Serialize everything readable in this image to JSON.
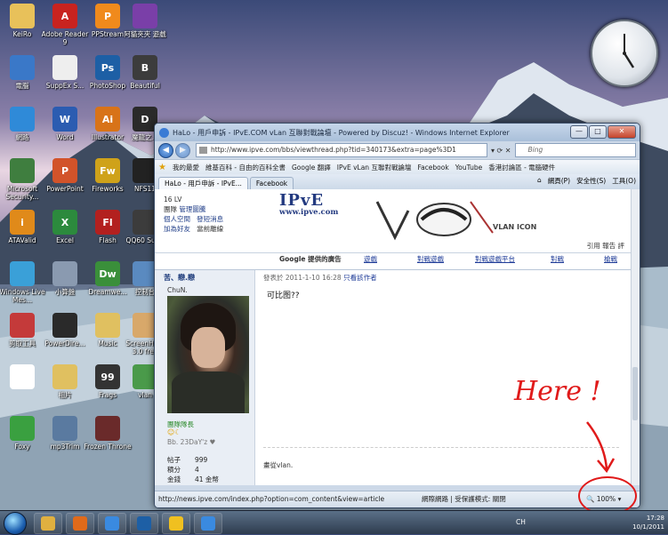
{
  "desktop_icons": [
    {
      "label": "KeiRo",
      "color": "#e8c15a",
      "glyph": ""
    },
    {
      "label": "Adobe Reader 9",
      "color": "#c8231f",
      "glyph": "A"
    },
    {
      "label": "PPStream",
      "color": "#f08a1c",
      "glyph": "P"
    },
    {
      "label": "阿貓夾夾 遊戲",
      "color": "#7a3fa8",
      "glyph": ""
    },
    {
      "label": "電腦",
      "color": "#3a78c8",
      "glyph": ""
    },
    {
      "label": "SuppEx S...",
      "color": "#eeeeee",
      "glyph": ""
    },
    {
      "label": "PhotoShop",
      "color": "#1d5fa5",
      "glyph": "Ps"
    },
    {
      "label": "Beautiful",
      "color": "#3c3c3c",
      "glyph": "B"
    },
    {
      "label": "網路",
      "color": "#2f8ad8",
      "glyph": ""
    },
    {
      "label": "Word",
      "color": "#2b5cb1",
      "glyph": "W"
    },
    {
      "label": "Illustrator",
      "color": "#d87318",
      "glyph": "Ai"
    },
    {
      "label": "魔龍之...",
      "color": "#2a2a2a",
      "glyph": "D"
    },
    {
      "label": "Microsoft Security...",
      "color": "#3f7e3f",
      "glyph": ""
    },
    {
      "label": "PowerPoint",
      "color": "#d2532a",
      "glyph": "P"
    },
    {
      "label": "Fireworks",
      "color": "#cfa21a",
      "glyph": "Fw"
    },
    {
      "label": "NFS11",
      "color": "#222222",
      "glyph": ""
    },
    {
      "label": "ATAValid",
      "color": "#e08a1a",
      "glyph": "i"
    },
    {
      "label": "Excel",
      "color": "#2c8a3d",
      "glyph": "X"
    },
    {
      "label": "Flash",
      "color": "#b3201f",
      "glyph": "Fl"
    },
    {
      "label": "QQ60 Sulte",
      "color": "#3c3c3c",
      "glyph": ""
    },
    {
      "label": "Windows Live Mes...",
      "color": "#3aa0d8",
      "glyph": ""
    },
    {
      "label": "小算盤",
      "color": "#8a9ab0",
      "glyph": ""
    },
    {
      "label": "Dreamwe...",
      "color": "#3a8f3a",
      "glyph": "Dw"
    },
    {
      "label": "控制台",
      "color": "#5a8ac0",
      "glyph": ""
    },
    {
      "label": "剪取工具",
      "color": "#c43a3a",
      "glyph": ""
    },
    {
      "label": "PowerDire...",
      "color": "#2a2a2a",
      "glyph": ""
    },
    {
      "label": "Music",
      "color": "#e0c060",
      "glyph": ""
    },
    {
      "label": "ScreenHu... 3.0 free",
      "color": "#d8a86a",
      "glyph": ""
    },
    {
      "label": "",
      "color": "#ffffff",
      "glyph": ""
    },
    {
      "label": "相片",
      "color": "#e0c060",
      "glyph": ""
    },
    {
      "label": "Frags",
      "color": "#333333",
      "glyph": "99"
    },
    {
      "label": "vlan",
      "color": "#4a9a4a",
      "glyph": ""
    },
    {
      "label": "Foxy",
      "color": "#3aa040",
      "glyph": ""
    },
    {
      "label": "mp3Trim",
      "color": "#5a7aa0",
      "glyph": ""
    },
    {
      "label": "Frozen Throne",
      "color": "#6a2a2a",
      "glyph": ""
    }
  ],
  "browser": {
    "title": "HaLo - 用戶申訴 - IPvE.COM vLan 互聯對戰論壇 - Powered by Discuz! - Windows Internet Explorer",
    "url": "http://www.ipve.com/bbs/viewthread.php?tid=340173&extra=page%3D1",
    "search_placeholder": "Bing",
    "favorites_bar": [
      "我的最愛",
      "維基百科 - 自由的百科全書",
      "Google 翻譯",
      "IPvE vLan 互聯對戰論壇",
      "Facebook",
      "YouTube",
      "香港討論區 - 電腦硬件"
    ],
    "tabs": [
      "HaLo - 用戶申訴 - IPvE...",
      "Facebook"
    ],
    "command_bar": [
      "網頁(P)",
      "安全性(S)",
      "工具(O)"
    ],
    "status_url": "http://news.ipve.com/index.php?option=com_content&view=article",
    "status_zone": "網際網路 | 受保護模式: 關閉",
    "zoom": "100%"
  },
  "page": {
    "logo": "IPvE",
    "logo_url": "www.ipve.com",
    "user_side": {
      "level": "16 LV",
      "admin_link": "管理圖騰",
      "links": [
        "個人空間",
        "發短消息",
        "加為好友",
        "當前離線"
      ]
    },
    "vlan_icon_label": "VLAN ICON",
    "tools": "引用 報告 評",
    "ad_label": "Google 提供的廣告",
    "ad_links": [
      "遊戲",
      "對戰遊戲",
      "對戰遊戲平台",
      "對戰",
      "槍戰"
    ],
    "author": {
      "name": "苦、戀.戀",
      "title": "ChuN.",
      "group": "團隊隊長",
      "tag": "Bb. 23DaY'z ♥",
      "stats": [
        {
          "label": "帖子",
          "value": "999"
        },
        {
          "label": "積分",
          "value": "4"
        },
        {
          "label": "金錢",
          "value": "41 金幣"
        }
      ]
    },
    "post_header": "發表於 2011-1-10 16:28",
    "post_header_link": "只看該作者",
    "post_body": "可比图??",
    "signature": "畫從vlan."
  },
  "annotation": {
    "text": "Here !",
    "color": "#e01a1a"
  },
  "taskbar": {
    "lang": "CH",
    "time": "17:28",
    "date": "10/1/2011",
    "apps": [
      {
        "name": "explorer",
        "color": "#e0b040"
      },
      {
        "name": "firefox",
        "color": "#e06a1a"
      },
      {
        "name": "internet-explorer",
        "color": "#3a8ae0"
      },
      {
        "name": "photoshop",
        "color": "#1d5fa5"
      },
      {
        "name": "qq",
        "color": "#f0c020"
      },
      {
        "name": "app",
        "color": "#3a8ae0"
      }
    ]
  }
}
